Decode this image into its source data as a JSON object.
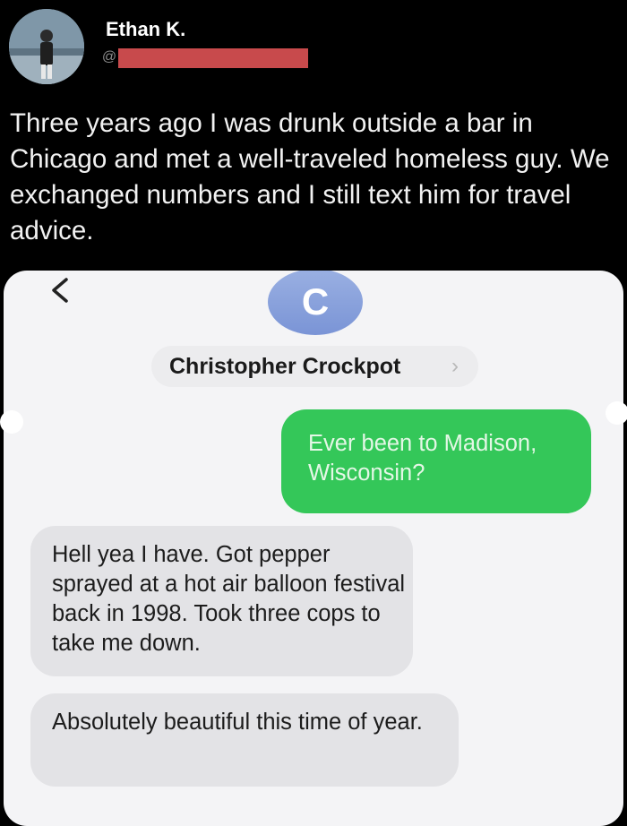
{
  "tweet": {
    "author_name": "Ethan K.",
    "handle_prefix": "@",
    "text": "Three years ago I was drunk outside a bar in Chicago and met a well-traveled homeless guy. We exchanged numbers and I still text him for travel advice."
  },
  "screenshot": {
    "back_icon": "chevron-left-icon",
    "contact_initial": "C",
    "contact_name": "Christopher Crockpot",
    "contact_chevron": "›",
    "messages": [
      {
        "side": "sent",
        "text": "Ever been to Madison, Wisconsin?"
      },
      {
        "side": "received",
        "text": "Hell yea I have. Got pepper sprayed at a hot air balloon festival back in 1998. Took three cops to take me down."
      },
      {
        "side": "received",
        "text": "Absolutely beautiful this time of year."
      }
    ]
  },
  "colors": {
    "background": "#000000",
    "sent_bubble": "#34c759",
    "received_bubble": "#e3e3e6",
    "contact_avatar": "#8aa3dc",
    "redaction": "#c84a4c"
  }
}
